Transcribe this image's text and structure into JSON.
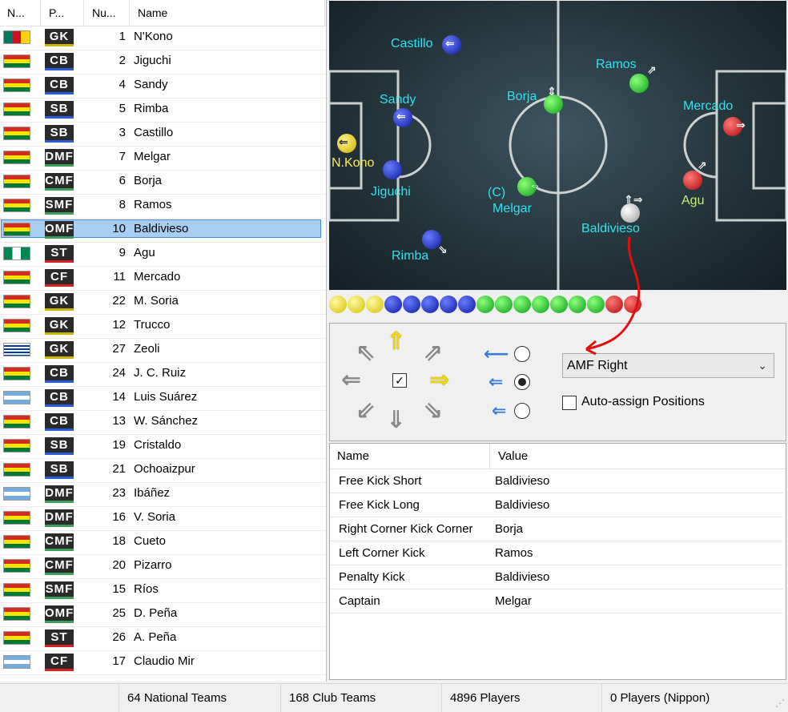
{
  "player_list": {
    "columns": [
      "N...",
      "P...",
      "Nu...",
      "Name"
    ],
    "rows": [
      {
        "flag": "cameroon",
        "pos": "GK",
        "num": "1",
        "name": "N'Kono"
      },
      {
        "flag": "bolivia",
        "pos": "CB",
        "num": "2",
        "name": "Jiguchi"
      },
      {
        "flag": "bolivia",
        "pos": "CB",
        "num": "4",
        "name": "Sandy"
      },
      {
        "flag": "bolivia",
        "pos": "SB",
        "num": "5",
        "name": "Rimba"
      },
      {
        "flag": "bolivia",
        "pos": "SB",
        "num": "3",
        "name": "Castillo"
      },
      {
        "flag": "bolivia",
        "pos": "DMF",
        "num": "7",
        "name": "Melgar"
      },
      {
        "flag": "bolivia",
        "pos": "CMF",
        "num": "6",
        "name": "Borja"
      },
      {
        "flag": "bolivia",
        "pos": "SMF",
        "num": "8",
        "name": "Ramos"
      },
      {
        "flag": "bolivia",
        "pos": "OMF",
        "num": "10",
        "name": "Baldivieso"
      },
      {
        "flag": "nigeria",
        "pos": "ST",
        "num": "9",
        "name": "Agu"
      },
      {
        "flag": "bolivia",
        "pos": "CF",
        "num": "11",
        "name": "Mercado"
      },
      {
        "flag": "bolivia",
        "pos": "GK",
        "num": "22",
        "name": "M. Soria"
      },
      {
        "flag": "bolivia",
        "pos": "GK",
        "num": "12",
        "name": "Trucco"
      },
      {
        "flag": "uruguay",
        "pos": "GK",
        "num": "27",
        "name": "Zeoli"
      },
      {
        "flag": "bolivia",
        "pos": "CB",
        "num": "24",
        "name": "J. C. Ruiz"
      },
      {
        "flag": "argentina",
        "pos": "CB",
        "num": "14",
        "name": "Luis Suárez"
      },
      {
        "flag": "bolivia",
        "pos": "CB",
        "num": "13",
        "name": "W. Sánchez"
      },
      {
        "flag": "bolivia",
        "pos": "SB",
        "num": "19",
        "name": "Cristaldo"
      },
      {
        "flag": "bolivia",
        "pos": "SB",
        "num": "21",
        "name": "Ochoaizpur"
      },
      {
        "flag": "argentina",
        "pos": "DMF",
        "num": "23",
        "name": "Ibáñez"
      },
      {
        "flag": "bolivia",
        "pos": "DMF",
        "num": "16",
        "name": "V. Soria"
      },
      {
        "flag": "bolivia",
        "pos": "CMF",
        "num": "18",
        "name": "Cueto"
      },
      {
        "flag": "bolivia",
        "pos": "CMF",
        "num": "20",
        "name": "Pizarro"
      },
      {
        "flag": "bolivia",
        "pos": "SMF",
        "num": "15",
        "name": "Ríos"
      },
      {
        "flag": "bolivia",
        "pos": "OMF",
        "num": "25",
        "name": "D. Peña"
      },
      {
        "flag": "bolivia",
        "pos": "ST",
        "num": "26",
        "name": "A. Peña"
      },
      {
        "flag": "argentina",
        "pos": "CF",
        "num": "17",
        "name": "Claudio Mir"
      }
    ],
    "selected_index": 8
  },
  "pitch": {
    "labels": {
      "castillo": "Castillo",
      "ramos": "Ramos",
      "sandy": "Sandy",
      "borja": "Borja",
      "mercado": "Mercado",
      "nkono": "N.Kono",
      "jiguchi": "Jiguchi",
      "captain": "(C)",
      "melgar": "Melgar",
      "agu": "Agu",
      "baldivieso": "Baldivieso",
      "rimba": "Rimba"
    }
  },
  "tactics": {
    "position_select": "AMF Right",
    "auto_assign_label": "Auto-assign Positions"
  },
  "set_pieces": {
    "columns": [
      "Name",
      "Value"
    ],
    "rows": [
      {
        "name": "Free Kick Short",
        "value": "Baldivieso"
      },
      {
        "name": "Free Kick Long",
        "value": "Baldivieso"
      },
      {
        "name": "Right Corner Kick Corner",
        "value": "Borja"
      },
      {
        "name": "Left Corner Kick",
        "value": "Ramos"
      },
      {
        "name": "Penalty Kick",
        "value": "Baldivieso"
      },
      {
        "name": "Captain",
        "value": "Melgar"
      }
    ]
  },
  "status_bar": {
    "national_teams": "64 National Teams",
    "club_teams": "168 Club Teams",
    "players": "4896 Players",
    "players_nippon": "0 Players (Nippon)"
  }
}
